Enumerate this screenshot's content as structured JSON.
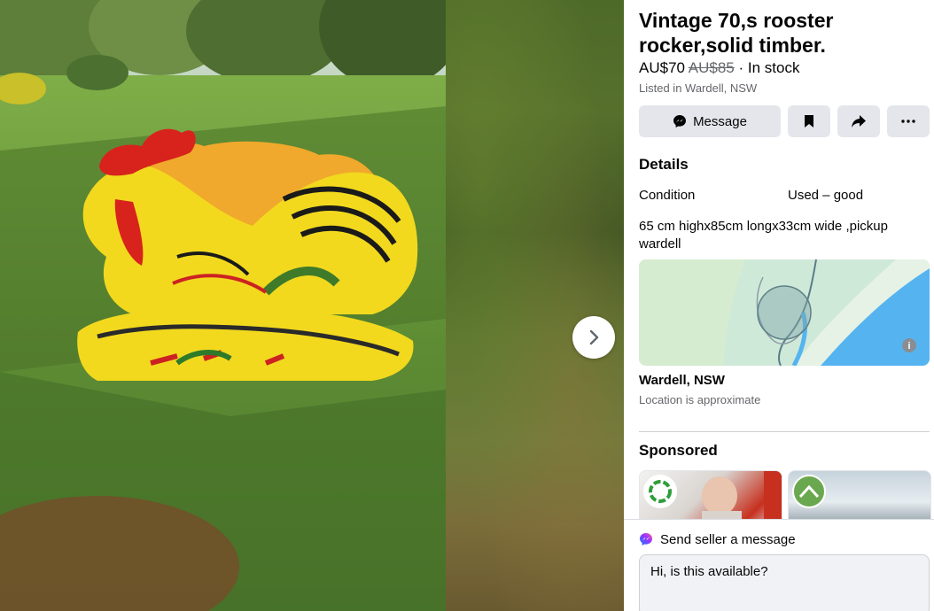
{
  "listing": {
    "title": "Vintage 70,s rooster rocker,solid timber.",
    "price": "AU$70",
    "old_price": "AU$85",
    "stock": " · In stock",
    "listed_in": "Listed in Wardell, NSW"
  },
  "actions": {
    "message_label": "Message",
    "save_icon": "bookmark-icon",
    "share_icon": "share-icon",
    "more_icon": "more-icon"
  },
  "details": {
    "heading": "Details",
    "condition_label": "Condition",
    "condition_value": "Used – good",
    "description": "65 cm highx85cm longx33cm wide ,pickup wardell"
  },
  "location": {
    "name": "Wardell, NSW",
    "note": "Location is approximate"
  },
  "sponsored": {
    "heading": "Sponsored"
  },
  "send": {
    "label": "Send seller a message",
    "input_value": "Hi, is this available?"
  },
  "colors": {
    "button_bg": "#e4e6eb",
    "secondary_text": "#65676b",
    "map_water": "#55b4f0",
    "map_land": "#cfe9d9"
  }
}
